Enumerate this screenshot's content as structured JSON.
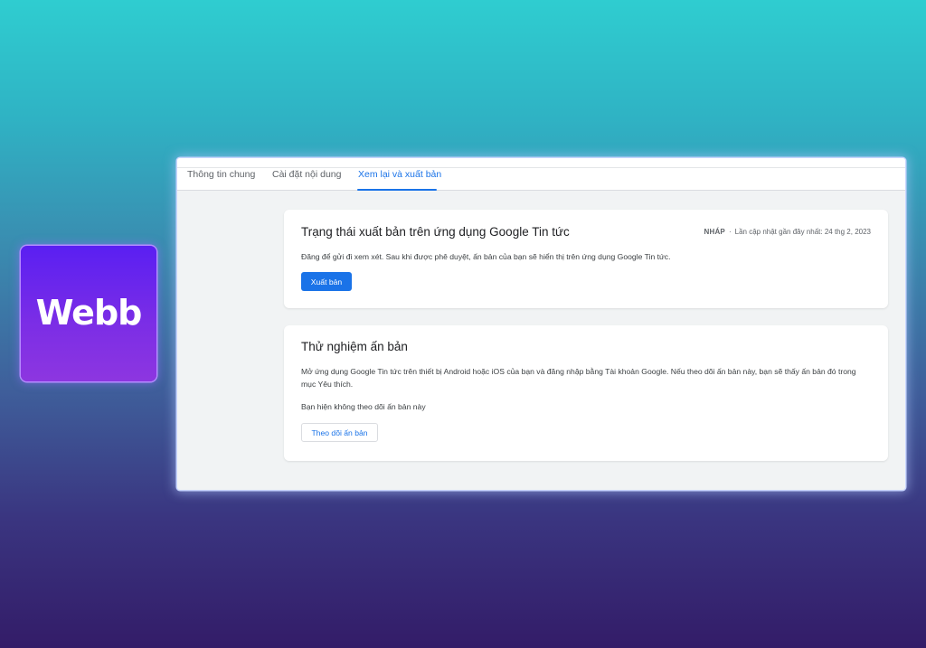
{
  "logo": {
    "text": "Webb"
  },
  "tabs": [
    {
      "label": "Thông tin chung",
      "active": false
    },
    {
      "label": "Cài đặt nội dung",
      "active": false
    },
    {
      "label": "Xem lại và xuất bản",
      "active": true
    }
  ],
  "publish_card": {
    "title": "Trạng thái xuất bản trên ứng dụng Google Tin tức",
    "status": "NHÁP",
    "separator": "·",
    "last_updated": "Lần cập nhật gần đây nhất: 24 thg 2, 2023",
    "description": "Đăng để gửi đi xem xét. Sau khi được phê duyệt, ấn bản của bạn sẽ hiển thị trên ứng dụng Google Tin tức.",
    "button_label": "Xuất bản"
  },
  "test_card": {
    "title": "Thử nghiệm ấn bản",
    "description": "Mở ứng dụng Google Tin tức trên thiết bị Android hoặc iOS của bạn và đăng nhập bằng Tài khoản Google. Nếu theo dõi ấn bản này, bạn sẽ thấy ấn bản đó trong mục Yêu thích.",
    "follow_status": "Bạn hiện không theo dõi ấn bản này",
    "button_label": "Theo dõi ấn bản"
  },
  "colors": {
    "accent": "#1a73e8",
    "logo_bg": "#6a24ee",
    "page_bg_top": "#2fcdd0",
    "page_bg_bottom": "#331c68"
  }
}
